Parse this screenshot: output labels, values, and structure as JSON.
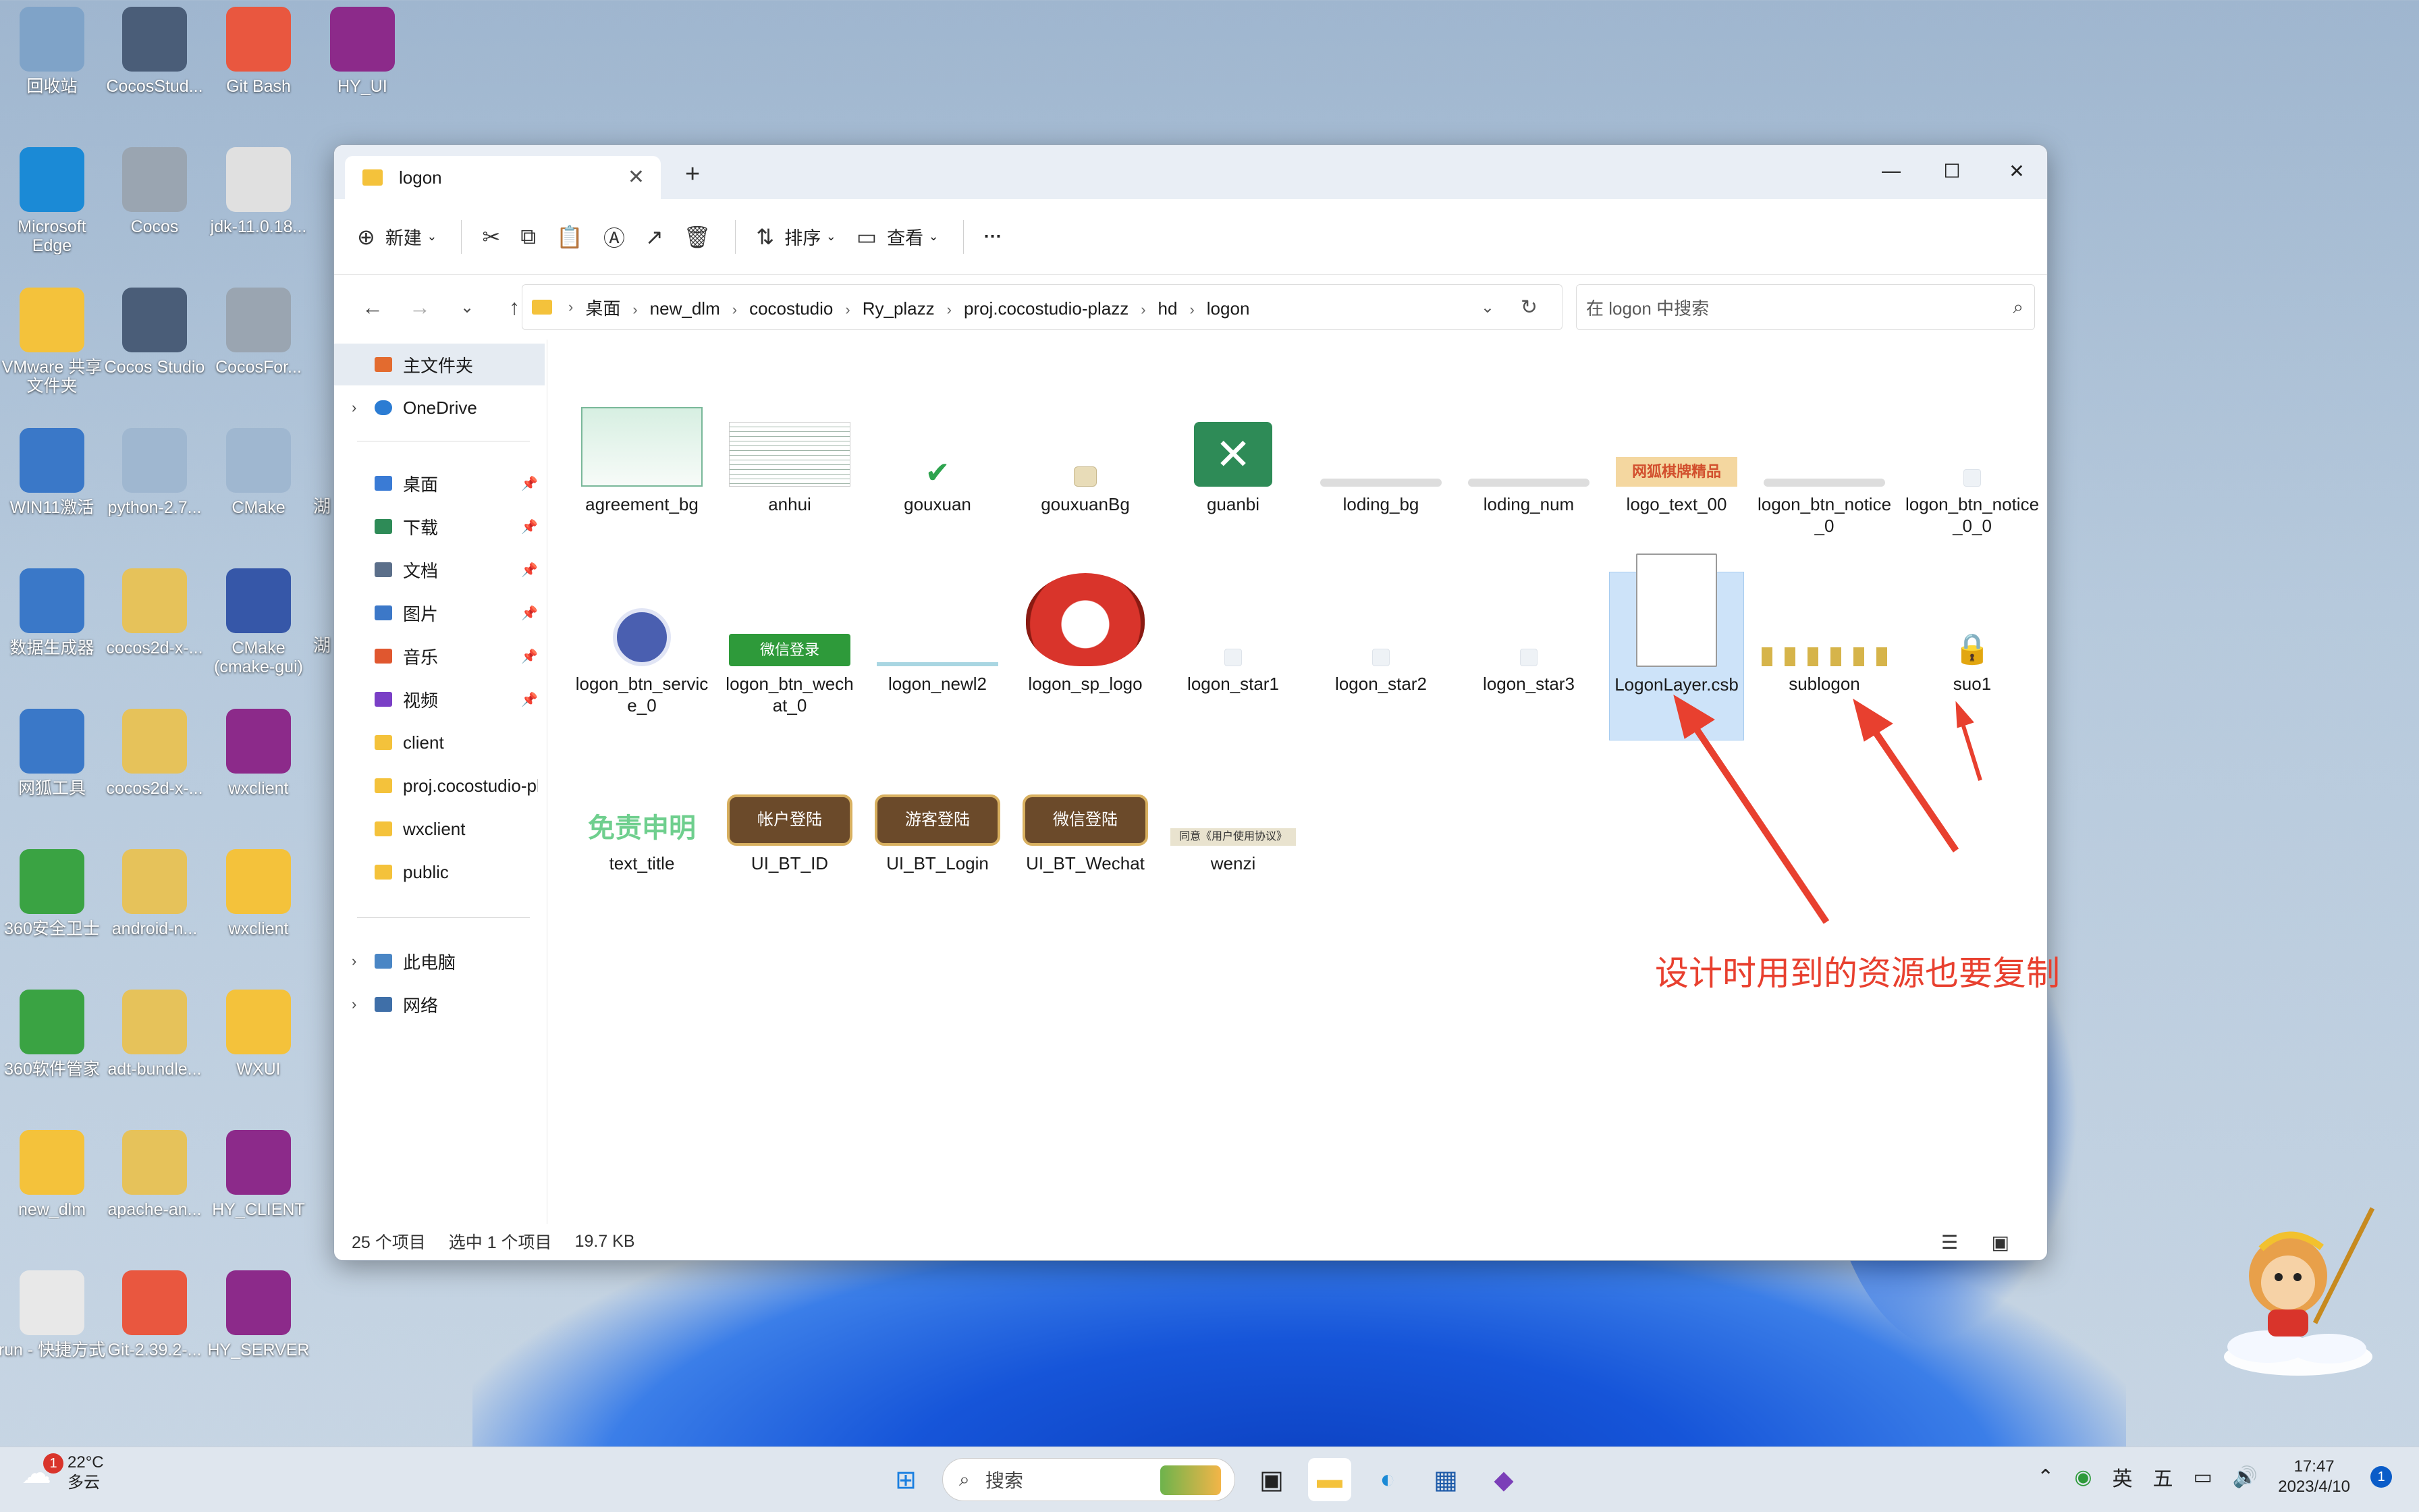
{
  "desktop": {
    "icons": [
      {
        "label": "回收站",
        "icon": "recycle-bin-icon"
      },
      {
        "label": "CocosStud...",
        "icon": "cocos-studio-icon"
      },
      {
        "label": "Git Bash",
        "icon": "git-bash-icon"
      },
      {
        "label": "HY_UI",
        "icon": "winrar-icon"
      },
      {
        "label": "Microsoft Edge",
        "icon": "edge-icon"
      },
      {
        "label": "Cocos",
        "icon": "cocos-icon"
      },
      {
        "label": "jdk-11.0.18...",
        "icon": "java-icon"
      },
      {
        "label": "VMware 共享文件夹",
        "icon": "folder-icon"
      },
      {
        "label": "Cocos Studio",
        "icon": "cocos-studio-icon"
      },
      {
        "label": "CocosFor...",
        "icon": "cocos-icon"
      },
      {
        "label": "WIN11激活",
        "icon": "app-icon"
      },
      {
        "label": "python-2.7...",
        "icon": "installer-icon"
      },
      {
        "label": "CMake",
        "icon": "installer-icon"
      },
      {
        "label": "数据生成器",
        "icon": "app-icon"
      },
      {
        "label": "cocos2d-x-...",
        "icon": "zip-folder-icon"
      },
      {
        "label": "CMake (cmake-gui)",
        "icon": "cmake-icon"
      },
      {
        "label": "网狐工具",
        "icon": "app-icon"
      },
      {
        "label": "cocos2d-x-...",
        "icon": "zip-folder-icon"
      },
      {
        "label": "wxclient",
        "icon": "winrar-icon"
      },
      {
        "label": "360安全卫士",
        "icon": "360-icon"
      },
      {
        "label": "android-n...",
        "icon": "zip-folder-icon"
      },
      {
        "label": "wxclient",
        "icon": "folder-icon"
      },
      {
        "label": "360软件管家",
        "icon": "360-icon"
      },
      {
        "label": "adt-bundle...",
        "icon": "zip-folder-icon"
      },
      {
        "label": "WXUI",
        "icon": "folder-icon"
      },
      {
        "label": "new_dlm",
        "icon": "folder-icon"
      },
      {
        "label": "apache-an...",
        "icon": "zip-folder-icon"
      },
      {
        "label": "HY_CLIENT",
        "icon": "winrar-icon"
      },
      {
        "label": "run - 快捷方式",
        "icon": "shortcut-icon"
      },
      {
        "label": "Git-2.39.2-...",
        "icon": "git-icon"
      },
      {
        "label": "HY_SERVER",
        "icon": "winrar-icon"
      }
    ],
    "edge_text_1": "湖",
    "edge_text_2": "湖"
  },
  "window": {
    "tab_title": "logon",
    "toolbar": {
      "new_label": "新建",
      "sort_label": "排序",
      "view_label": "查看",
      "more_label": "···"
    },
    "breadcrumb": [
      "桌面",
      "new_dlm",
      "cocostudio",
      "Ry_plazz",
      "proj.cocostudio-plazz",
      "hd",
      "logon"
    ],
    "search_placeholder": "在 logon 中搜索",
    "sidebar": {
      "home": "主文件夹",
      "onedrive": "OneDrive",
      "quick": [
        {
          "label": "桌面",
          "color": "#3a7bd5"
        },
        {
          "label": "下载",
          "color": "#2e8b57"
        },
        {
          "label": "文档",
          "color": "#5b6f8a"
        },
        {
          "label": "图片",
          "color": "#3c78c8"
        },
        {
          "label": "音乐",
          "color": "#e0572f"
        },
        {
          "label": "视频",
          "color": "#7a3fc6"
        },
        {
          "label": "client",
          "color": "#f4c23b"
        },
        {
          "label": "proj.cocostudio-pl",
          "color": "#f4c23b"
        },
        {
          "label": "wxclient",
          "color": "#f4c23b"
        },
        {
          "label": "public",
          "color": "#f4c23b"
        }
      ],
      "this_pc": "此电脑",
      "network": "网络"
    },
    "files": [
      {
        "name": "agreement_bg",
        "kind": "bg"
      },
      {
        "name": "anhui",
        "kind": "doc"
      },
      {
        "name": "gouxuan",
        "kind": "check"
      },
      {
        "name": "gouxuanBg",
        "kind": "box"
      },
      {
        "name": "guanbi",
        "kind": "close"
      },
      {
        "name": "loding_bg",
        "kind": "bar"
      },
      {
        "name": "loding_num",
        "kind": "bar"
      },
      {
        "name": "logo_text_00",
        "kind": "logo"
      },
      {
        "name": "logon_btn_notice_0",
        "kind": "bar"
      },
      {
        "name": "logon_btn_notice_0_0",
        "kind": "small"
      },
      {
        "name": "logon_btn_service_0",
        "kind": "avatar"
      },
      {
        "name": "logon_btn_wechat_0",
        "kind": "green-btn"
      },
      {
        "name": "logon_newl2",
        "kind": "line"
      },
      {
        "name": "logon_sp_logo",
        "kind": "fox"
      },
      {
        "name": "logon_star1",
        "kind": "small"
      },
      {
        "name": "logon_star2",
        "kind": "small"
      },
      {
        "name": "logon_star3",
        "kind": "small"
      },
      {
        "name": "LogonLayer.csb",
        "kind": "file"
      },
      {
        "name": "sublogon",
        "kind": "strip"
      },
      {
        "name": "suo1",
        "kind": "lock"
      },
      {
        "name": "text_title",
        "kind": "title"
      },
      {
        "name": "UI_BT_ID",
        "kind": "game-btn"
      },
      {
        "name": "UI_BT_Login",
        "kind": "game-btn"
      },
      {
        "name": "UI_BT_Wechat",
        "kind": "game-btn"
      },
      {
        "name": "wenzi",
        "kind": "tiny-text"
      }
    ],
    "thumb_text": {
      "logo_text": "网狐棋牌精品",
      "wechat_btn": "微信登录",
      "title_text": "免责申明",
      "bt_id": "帐户登陆",
      "bt_login": "游客登陆",
      "bt_wechat": "微信登陆",
      "wenzi_text": "同意《用户使用协议》"
    },
    "status": {
      "count": "25 个项目",
      "selection": "选中 1 个项目",
      "size": "19.7 KB"
    }
  },
  "annotation": "设计时用到的资源也要复制",
  "taskbar": {
    "weather_badge": "1",
    "temperature": "22°C",
    "condition": "多云",
    "search_label": "搜索",
    "ime_lang": "英",
    "ime_mode": "五",
    "time": "17:47",
    "date": "2023/4/10",
    "notification_count": "1"
  }
}
